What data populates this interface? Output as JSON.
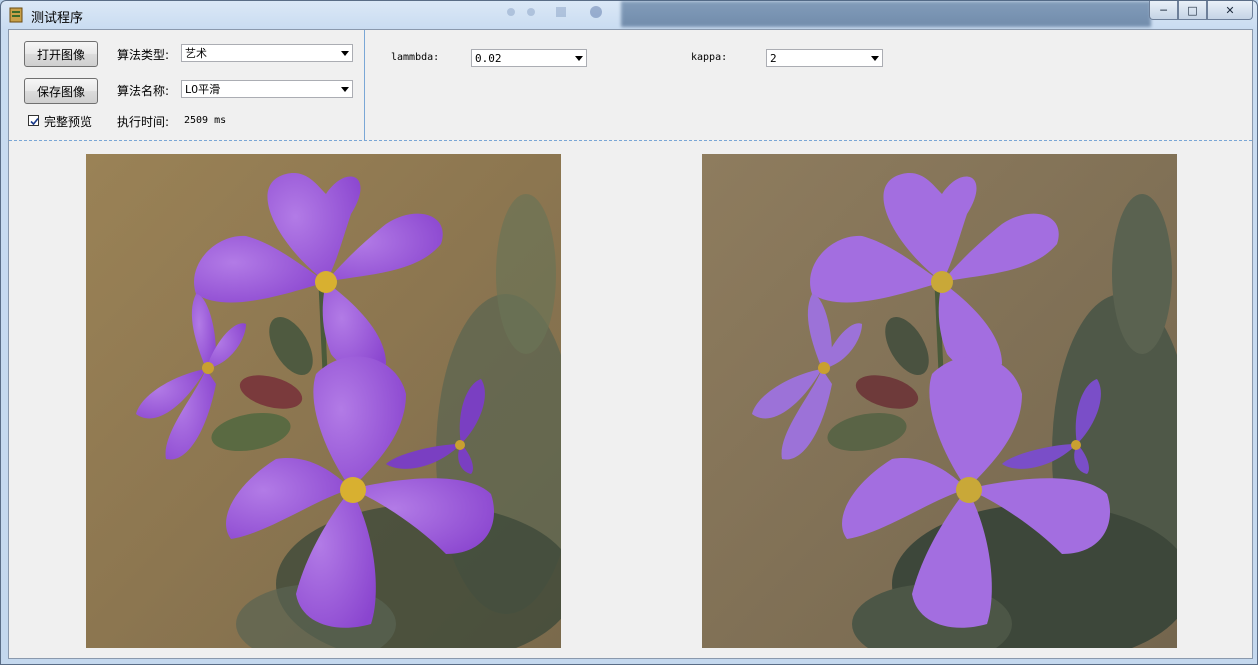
{
  "window": {
    "title": "测试程序",
    "controls": {
      "minimize": "─",
      "maximize": "□",
      "close": "✕"
    }
  },
  "toolbar": {
    "open_label": "打开图像",
    "save_label": "保存图像",
    "preview_label": "完整预览",
    "preview_checked": true
  },
  "algo": {
    "type_label": "算法类型:",
    "type_value": "艺术",
    "name_label": "算法名称:",
    "name_value": "L0平滑",
    "time_label": "执行时间:",
    "time_value": "2509 ms"
  },
  "params": {
    "lambda_label": "lammbda:",
    "lambda_value": "0.02",
    "kappa_label": "kappa:",
    "kappa_value": "2"
  },
  "images": {
    "original": "purple-flower-photo",
    "smoothed": "purple-flower-smoothed"
  },
  "colors": {
    "accent_line": "#7aa7d6",
    "petal": "#9b55d6",
    "petal_smooth": "#a36ee0"
  }
}
